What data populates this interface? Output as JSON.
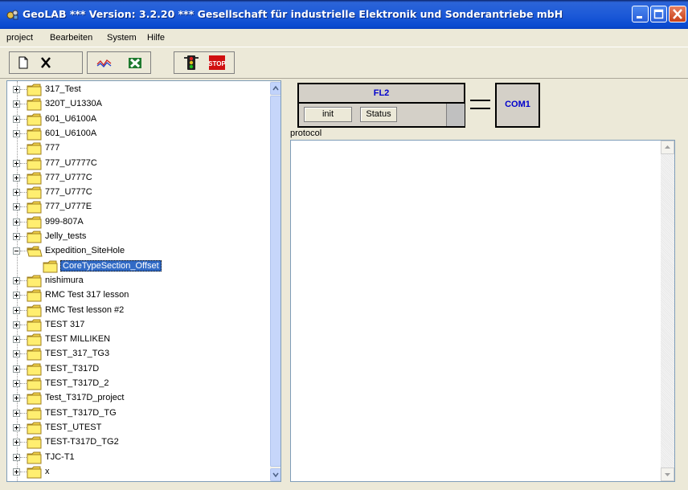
{
  "window": {
    "title": "GeoLAB   *** Version: 3.2.20 ***   Gesellschaft für industrielle Elektronik und Sonderantriebe mbH",
    "icon": "geolab-app-icon",
    "controls": [
      "minimize",
      "maximize",
      "close"
    ]
  },
  "menu": [
    "project",
    "Bearbeiten",
    "System",
    "Hilfe"
  ],
  "toolbar": {
    "buttons": [
      "new-document-icon",
      "delete-x-icon",
      "chart-icon",
      "excel-icon",
      "traffic-light-icon",
      "stop-icon"
    ],
    "stop_label": "STOP"
  },
  "tree": {
    "items": [
      {
        "label": "317_Test",
        "expander": "plus"
      },
      {
        "label": "320T_U1330A",
        "expander": "plus"
      },
      {
        "label": "601_U6100A",
        "expander": "plus"
      },
      {
        "label": "601_U6100A",
        "expander": "plus"
      },
      {
        "label": "777",
        "expander": "none"
      },
      {
        "label": "777_U7777C",
        "expander": "plus"
      },
      {
        "label": "777_U777C",
        "expander": "plus"
      },
      {
        "label": "777_U777C",
        "expander": "plus"
      },
      {
        "label": "777_U777E",
        "expander": "plus"
      },
      {
        "label": "999-807A",
        "expander": "plus"
      },
      {
        "label": "Jelly_tests",
        "expander": "plus"
      },
      {
        "label": "Expedition_SiteHole",
        "expander": "minus"
      },
      {
        "label": "CoreTypeSection_Offset",
        "expander": "none",
        "child": true,
        "selected": true
      },
      {
        "label": "nishimura",
        "expander": "plus"
      },
      {
        "label": "RMC Test 317 lesson",
        "expander": "plus"
      },
      {
        "label": "RMC Test lesson #2",
        "expander": "plus"
      },
      {
        "label": "TEST 317",
        "expander": "plus"
      },
      {
        "label": "TEST MILLIKEN",
        "expander": "plus"
      },
      {
        "label": "TEST_317_TG3",
        "expander": "plus"
      },
      {
        "label": "TEST_T317D",
        "expander": "plus"
      },
      {
        "label": "TEST_T317D_2",
        "expander": "plus"
      },
      {
        "label": "Test_T317D_project",
        "expander": "plus"
      },
      {
        "label": "TEST_T317D_TG",
        "expander": "plus"
      },
      {
        "label": "TEST_UTEST",
        "expander": "plus"
      },
      {
        "label": "TEST-T317D_TG2",
        "expander": "plus"
      },
      {
        "label": "TJC-T1",
        "expander": "plus"
      },
      {
        "label": "x",
        "expander": "plus"
      }
    ]
  },
  "device": {
    "name": "FL2",
    "init_label": "init",
    "status_label": "Status",
    "port": "COM1"
  },
  "protocol": {
    "label": "protocol",
    "content": ""
  }
}
